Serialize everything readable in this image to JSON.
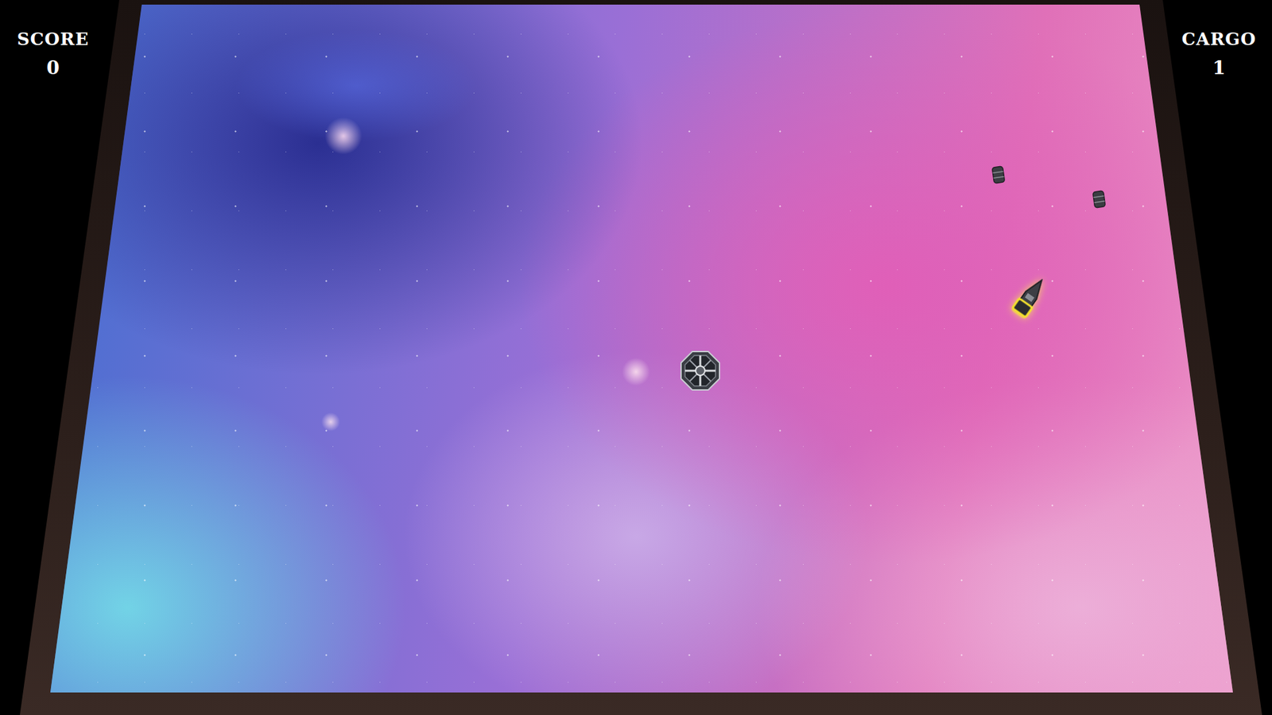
{
  "hud": {
    "score": {
      "label": "SCORE",
      "value": "0"
    },
    "cargo": {
      "label": "CARGO",
      "value": "1"
    }
  },
  "entities": [
    {
      "kind": "station"
    },
    {
      "kind": "ship"
    },
    {
      "kind": "barrel"
    },
    {
      "kind": "barrel"
    }
  ]
}
